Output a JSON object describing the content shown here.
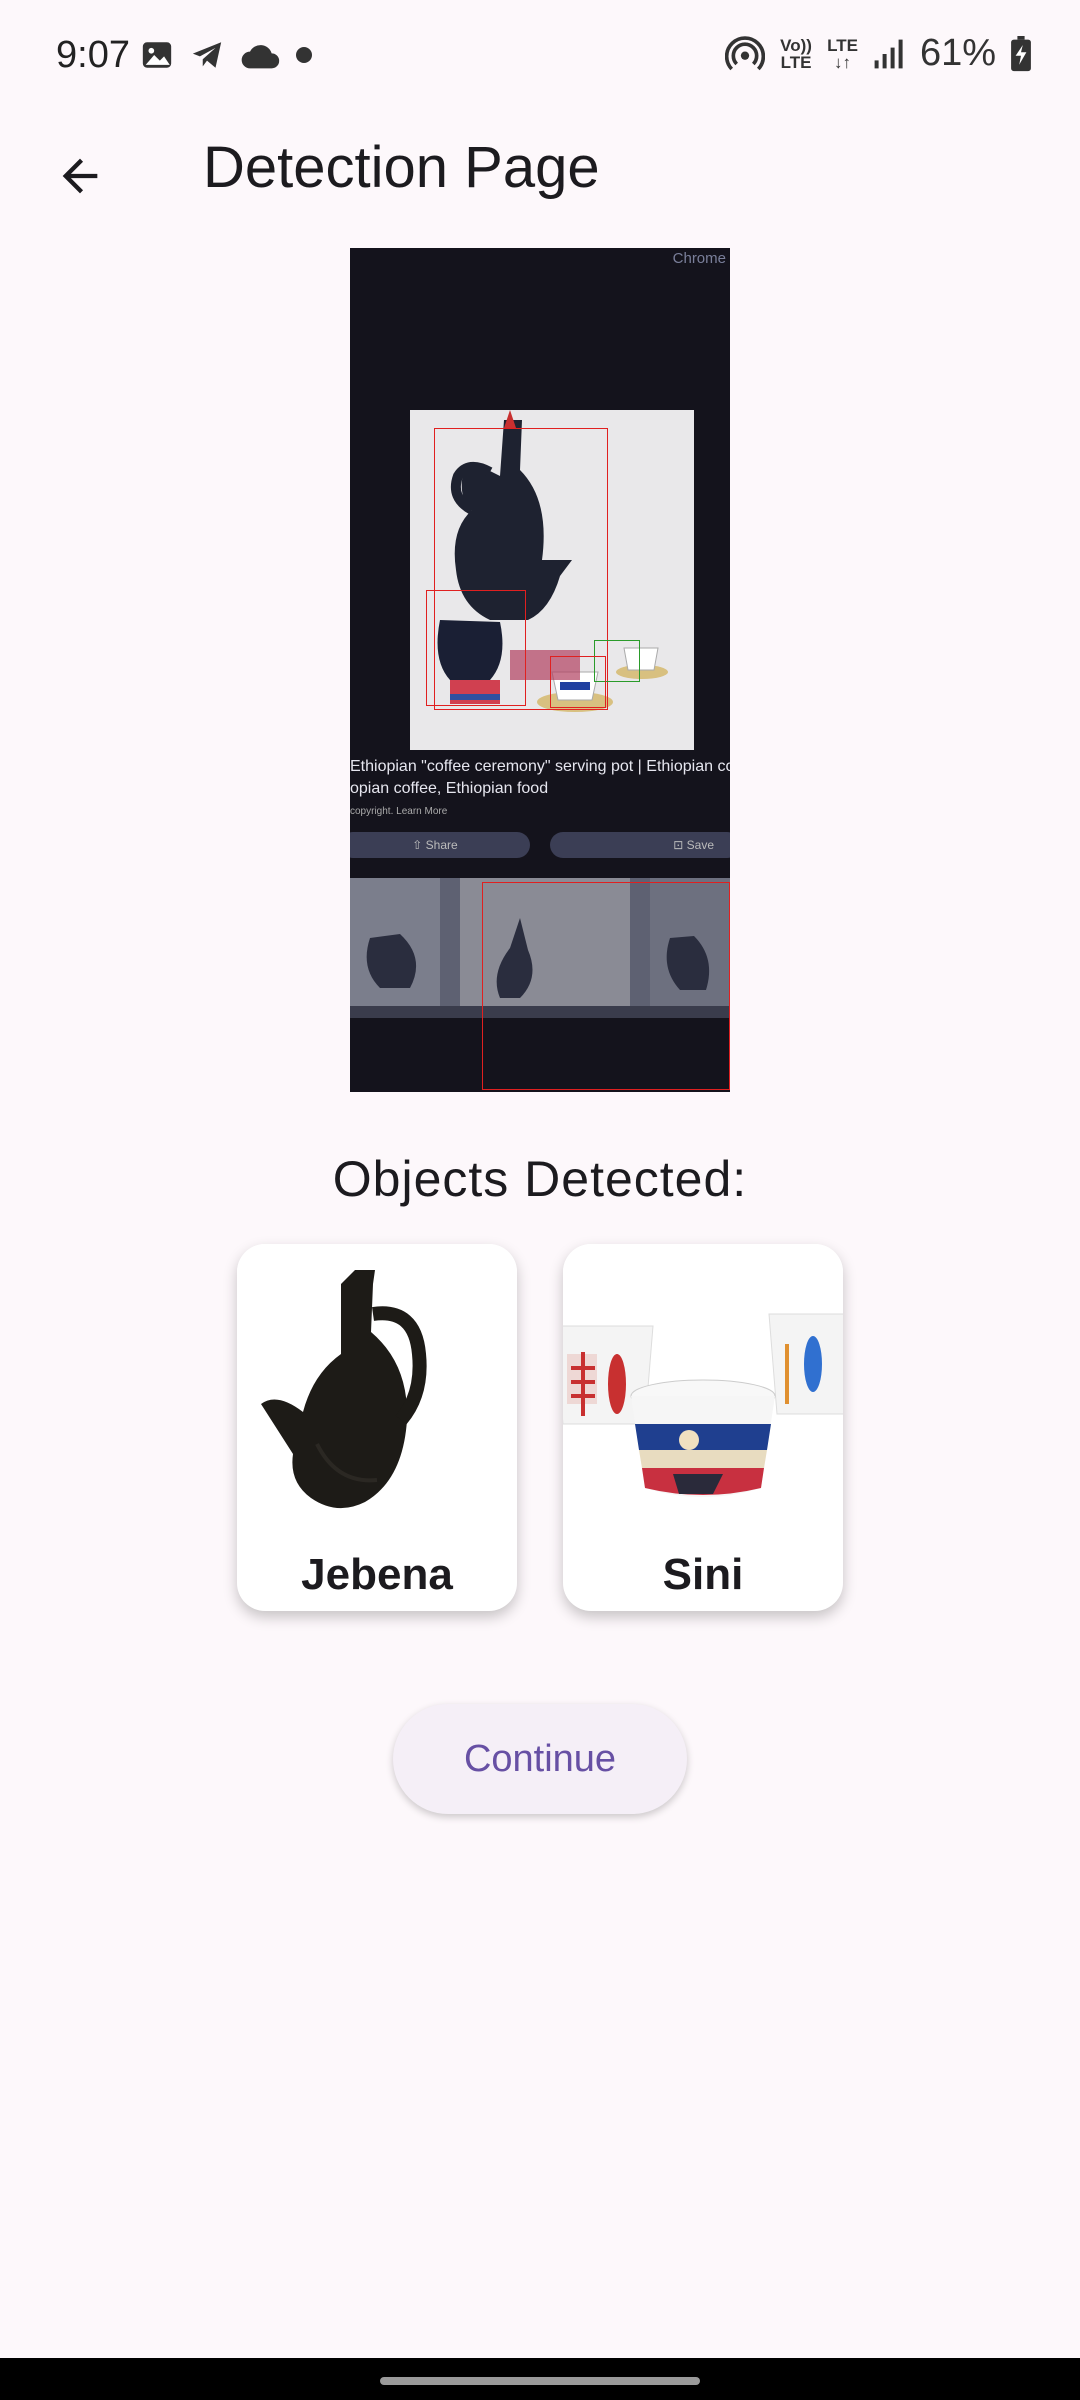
{
  "status_bar": {
    "time": "9:07",
    "battery_percent": "61%",
    "network_label": "LTE",
    "volte_label": "Vo)) LTE",
    "icons_left": [
      "image-icon",
      "telegram-icon",
      "cloud-icon",
      "dot-icon"
    ],
    "icons_right": [
      "hotspot-icon",
      "volte-icon",
      "lte-icon",
      "signal-icon",
      "battery-icon"
    ]
  },
  "app_bar": {
    "title": "Detection Page",
    "back_icon": "arrow-back-icon"
  },
  "detection_image": {
    "caption_line1": "Ethiopian \"coffee ceremony\" serving pot | Ethiopian coffee",
    "caption_line2": "opian coffee, Ethiopian food",
    "caption_line3": "copyright. Learn More",
    "share_label": "Share",
    "save_label": "Save",
    "chrome_label": "Chrome"
  },
  "objects_section": {
    "title": "Objects Detected:",
    "items": [
      {
        "label": "Jebena"
      },
      {
        "label": "Sini"
      }
    ]
  },
  "continue_button": {
    "label": "Continue"
  },
  "colors": {
    "background": "#fdf8fb",
    "accent": "#6750a4",
    "box_red": "#e02020",
    "box_green": "#2a9b2a"
  }
}
